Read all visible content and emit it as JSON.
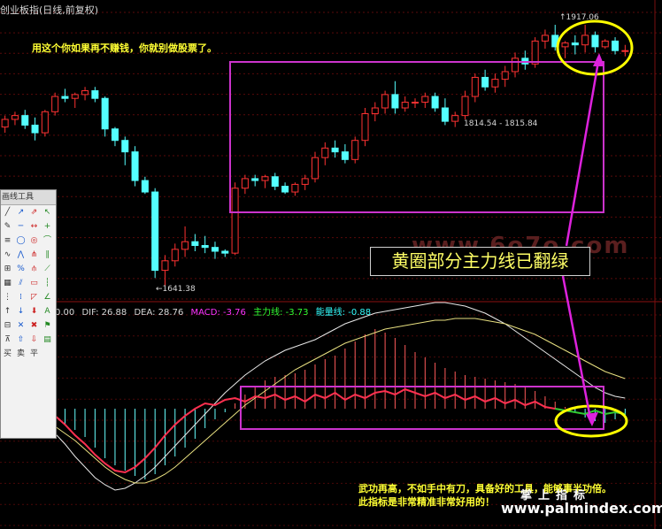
{
  "chart_title": "创业板指(日线,前复权)",
  "notes": {
    "top": "用这个你如果再不赚钱，你就别做股票了。",
    "bottom_line1": "武功再高，不如手中有刀，具备好的工具，能够事半功倍。",
    "bottom_line2": "此指标是非常精准非常好用的！"
  },
  "callout": "黄圈部分主力线已翻绿",
  "watermark": "www.6o7o.com",
  "brand": {
    "cn": "掌上指标",
    "url": "www.palmindex.com"
  },
  "price_labels": {
    "high": "1917.06",
    "low": "1641.38",
    "range": "1814.54 - 1815.84"
  },
  "indicator": {
    "lead": "0.00",
    "dif_label": "DIF: 26.88",
    "dea_label": "DEA: 28.76",
    "macd_label": "MACD: -3.76",
    "main_label": "主力线: -3.73",
    "energy_label": "能量线: -0.88",
    "colors": {
      "dif": "#d8d8d8",
      "dea": "#d8d8d8",
      "macd": "#ff33ff",
      "main": "#33ff33",
      "energy": "#33ffff"
    }
  },
  "toolbox": {
    "title": "画线工具",
    "tools": [
      "line-tool",
      "ray-tool",
      "arrow-line-tool",
      "arrow-tool",
      "pen-tool",
      "horizontal-line-tool",
      "segment-tool",
      "cross-tool",
      "fibonacci-tool",
      "circle-tool",
      "ellipse-tool",
      "arc-tool",
      "wave-tool",
      "zigzag-tool",
      "fork-tool",
      "channel-tool",
      "gann-tool",
      "ratio-tool",
      "pitchfork-tool",
      "speed-line-tool",
      "grid-tool",
      "parallel-tool",
      "box-tool",
      "period-tool",
      "cycle-tool",
      "dense-cycle-tool",
      "fan-tool",
      "angle-tool",
      "up-arrow-tool",
      "down-arrow-tool",
      "fill-arrow-tool",
      "text-tool",
      "table-tool",
      "clear-tool",
      "delete-tool",
      "flag-tool",
      "up-mark-tool",
      "buy-mark-tool",
      "sell-mark-tool",
      "note-mark-tool"
    ],
    "footer_labels": [
      "买",
      "卖",
      "平"
    ]
  },
  "colors": {
    "up": "#ff3232",
    "down": "#54ffff",
    "frame": "#cc33cc",
    "circle": "#ffff00",
    "arrow": "#dd22dd"
  },
  "chart_data": {
    "type": "candlestick",
    "series": [
      {
        "open": 1810,
        "high": 1822,
        "low": 1804,
        "close": 1818
      },
      {
        "open": 1818,
        "high": 1826,
        "low": 1812,
        "close": 1822
      },
      {
        "open": 1822,
        "high": 1828,
        "low": 1808,
        "close": 1812
      },
      {
        "open": 1812,
        "high": 1820,
        "low": 1796,
        "close": 1804
      },
      {
        "open": 1804,
        "high": 1828,
        "low": 1800,
        "close": 1826
      },
      {
        "open": 1826,
        "high": 1846,
        "low": 1822,
        "close": 1842
      },
      {
        "open": 1842,
        "high": 1850,
        "low": 1836,
        "close": 1840
      },
      {
        "open": 1840,
        "high": 1846,
        "low": 1830,
        "close": 1844
      },
      {
        "open": 1844,
        "high": 1852,
        "low": 1838,
        "close": 1848
      },
      {
        "open": 1848,
        "high": 1852,
        "low": 1836,
        "close": 1840
      },
      {
        "open": 1840,
        "high": 1842,
        "low": 1800,
        "close": 1808
      },
      {
        "open": 1808,
        "high": 1810,
        "low": 1790,
        "close": 1796
      },
      {
        "open": 1796,
        "high": 1800,
        "low": 1770,
        "close": 1784
      },
      {
        "open": 1784,
        "high": 1790,
        "low": 1748,
        "close": 1754
      },
      {
        "open": 1754,
        "high": 1758,
        "low": 1740,
        "close": 1742
      },
      {
        "open": 1742,
        "high": 1746,
        "low": 1652,
        "close": 1660
      },
      {
        "open": 1660,
        "high": 1676,
        "low": 1644,
        "close": 1670
      },
      {
        "open": 1670,
        "high": 1688,
        "low": 1664,
        "close": 1682
      },
      {
        "open": 1682,
        "high": 1706,
        "low": 1674,
        "close": 1690
      },
      {
        "open": 1690,
        "high": 1698,
        "low": 1680,
        "close": 1686
      },
      {
        "open": 1686,
        "high": 1696,
        "low": 1678,
        "close": 1684
      },
      {
        "open": 1684,
        "high": 1690,
        "low": 1672,
        "close": 1680
      },
      {
        "open": 1680,
        "high": 1682,
        "low": 1674,
        "close": 1678
      },
      {
        "open": 1678,
        "high": 1752,
        "low": 1676,
        "close": 1746
      },
      {
        "open": 1746,
        "high": 1760,
        "low": 1740,
        "close": 1756
      },
      {
        "open": 1756,
        "high": 1760,
        "low": 1748,
        "close": 1754
      },
      {
        "open": 1754,
        "high": 1760,
        "low": 1746,
        "close": 1758
      },
      {
        "open": 1758,
        "high": 1762,
        "low": 1744,
        "close": 1748
      },
      {
        "open": 1748,
        "high": 1752,
        "low": 1740,
        "close": 1742
      },
      {
        "open": 1742,
        "high": 1752,
        "low": 1738,
        "close": 1750
      },
      {
        "open": 1750,
        "high": 1760,
        "low": 1744,
        "close": 1756
      },
      {
        "open": 1756,
        "high": 1784,
        "low": 1752,
        "close": 1778
      },
      {
        "open": 1778,
        "high": 1794,
        "low": 1770,
        "close": 1788
      },
      {
        "open": 1788,
        "high": 1796,
        "low": 1778,
        "close": 1784
      },
      {
        "open": 1784,
        "high": 1792,
        "low": 1772,
        "close": 1776
      },
      {
        "open": 1776,
        "high": 1800,
        "low": 1772,
        "close": 1796
      },
      {
        "open": 1796,
        "high": 1830,
        "low": 1790,
        "close": 1824
      },
      {
        "open": 1824,
        "high": 1836,
        "low": 1816,
        "close": 1830
      },
      {
        "open": 1830,
        "high": 1848,
        "low": 1824,
        "close": 1844
      },
      {
        "open": 1844,
        "high": 1858,
        "low": 1824,
        "close": 1830
      },
      {
        "open": 1830,
        "high": 1842,
        "low": 1826,
        "close": 1836
      },
      {
        "open": 1836,
        "high": 1840,
        "low": 1830,
        "close": 1836
      },
      {
        "open": 1836,
        "high": 1846,
        "low": 1830,
        "close": 1842
      },
      {
        "open": 1842,
        "high": 1846,
        "low": 1826,
        "close": 1830
      },
      {
        "open": 1830,
        "high": 1840,
        "low": 1812,
        "close": 1816
      },
      {
        "open": 1816,
        "high": 1826,
        "low": 1810,
        "close": 1822
      },
      {
        "open": 1822,
        "high": 1848,
        "low": 1818,
        "close": 1842
      },
      {
        "open": 1842,
        "high": 1866,
        "low": 1836,
        "close": 1862
      },
      {
        "open": 1862,
        "high": 1870,
        "low": 1848,
        "close": 1852
      },
      {
        "open": 1852,
        "high": 1866,
        "low": 1846,
        "close": 1860
      },
      {
        "open": 1860,
        "high": 1874,
        "low": 1852,
        "close": 1868
      },
      {
        "open": 1868,
        "high": 1888,
        "low": 1862,
        "close": 1882
      },
      {
        "open": 1882,
        "high": 1890,
        "low": 1870,
        "close": 1876
      },
      {
        "open": 1876,
        "high": 1904,
        "low": 1872,
        "close": 1900
      },
      {
        "open": 1900,
        "high": 1912,
        "low": 1892,
        "close": 1906
      },
      {
        "open": 1906,
        "high": 1917,
        "low": 1890,
        "close": 1894
      },
      {
        "open": 1894,
        "high": 1900,
        "low": 1882,
        "close": 1898
      },
      {
        "open": 1898,
        "high": 1906,
        "low": 1886,
        "close": 1896
      },
      {
        "open": 1896,
        "high": 1917,
        "low": 1888,
        "close": 1906
      },
      {
        "open": 1906,
        "high": 1910,
        "low": 1888,
        "close": 1894
      },
      {
        "open": 1894,
        "high": 1902,
        "low": 1892,
        "close": 1900
      },
      {
        "open": 1900,
        "high": 1904,
        "low": 1886,
        "close": 1890
      },
      {
        "open": 1890,
        "high": 1896,
        "low": 1884,
        "close": 1890
      }
    ],
    "price_range": [
      1630,
      1930
    ],
    "macd_histogram": [
      0.9,
      0.6,
      0.2,
      -0.2,
      -0.5,
      -0.7,
      -0.9,
      -1.2,
      -1.6,
      -2.2,
      -2.8,
      -3.2,
      -3.5,
      -3.8,
      -4.0,
      -3.7,
      -3.2,
      -2.7,
      -2.2,
      -1.7,
      -1.1,
      -0.6,
      -0.2,
      0.3,
      0.8,
      1.3,
      1.6,
      1.8,
      1.9,
      2.0,
      2.2,
      2.5,
      2.8,
      3.0,
      3.4,
      3.8,
      4.2,
      4.5,
      4.3,
      4.0,
      3.6,
      3.2,
      2.9,
      2.6,
      2.3,
      2.1,
      1.9,
      1.8,
      1.7,
      1.6,
      1.5,
      1.4,
      1.2,
      1.0,
      0.7,
      0.4,
      0.1,
      -0.2,
      -0.5,
      -0.7,
      -0.8,
      -0.6,
      -0.4
    ],
    "dif": [
      -0.5,
      -0.4,
      -0.3,
      -0.4,
      -0.8,
      -1.4,
      -2.0,
      -2.7,
      -3.3,
      -3.9,
      -4.3,
      -4.6,
      -4.5,
      -4.2,
      -3.8,
      -3.3,
      -2.7,
      -2.1,
      -1.5,
      -0.9,
      -0.3,
      0.3,
      0.9,
      1.4,
      1.9,
      2.3,
      2.7,
      3.0,
      3.3,
      3.5,
      3.7,
      3.9,
      4.2,
      4.5,
      4.8,
      5.0,
      5.2,
      5.4,
      5.5,
      5.6,
      5.7,
      5.8,
      5.9,
      6.0,
      6.0,
      5.9,
      5.8,
      5.6,
      5.4,
      5.1,
      4.8,
      4.4,
      4.0,
      3.6,
      3.2,
      2.8,
      2.4,
      2.0,
      1.6,
      1.2,
      0.9,
      0.7,
      0.6
    ],
    "dea": [
      -0.4,
      -0.4,
      -0.4,
      -0.5,
      -0.7,
      -1.0,
      -1.4,
      -1.8,
      -2.3,
      -2.8,
      -3.3,
      -3.7,
      -4.0,
      -4.2,
      -4.2,
      -4.0,
      -3.7,
      -3.3,
      -2.8,
      -2.3,
      -1.8,
      -1.3,
      -0.8,
      -0.3,
      0.2,
      0.6,
      1.0,
      1.4,
      1.8,
      2.2,
      2.5,
      2.8,
      3.1,
      3.4,
      3.7,
      3.9,
      4.1,
      4.3,
      4.5,
      4.6,
      4.7,
      4.8,
      4.9,
      5.0,
      5.0,
      5.1,
      5.1,
      5.1,
      5.0,
      4.9,
      4.8,
      4.6,
      4.4,
      4.2,
      3.9,
      3.6,
      3.3,
      3.0,
      2.7,
      2.4,
      2.1,
      1.9,
      1.7
    ],
    "main_line": [
      0.4,
      0.6,
      0.5,
      0.3,
      0.0,
      -0.4,
      -0.9,
      -1.5,
      -2.0,
      -2.6,
      -3.1,
      -3.5,
      -3.6,
      -3.3,
      -2.8,
      -2.2,
      -1.5,
      -0.9,
      -0.4,
      0.0,
      0.3,
      0.2,
      0.5,
      0.6,
      0.4,
      0.7,
      0.6,
      0.8,
      0.5,
      0.7,
      0.4,
      0.8,
      0.6,
      0.9,
      0.5,
      0.8,
      0.6,
      0.9,
      1.0,
      0.8,
      1.1,
      0.9,
      0.7,
      0.9,
      0.6,
      0.8,
      0.5,
      0.7,
      0.4,
      0.6,
      0.3,
      0.5,
      0.2,
      0.4,
      0.1,
      0.0,
      -0.1,
      -0.2,
      -0.3,
      -0.1,
      -0.3,
      -0.2,
      -0.3
    ]
  }
}
